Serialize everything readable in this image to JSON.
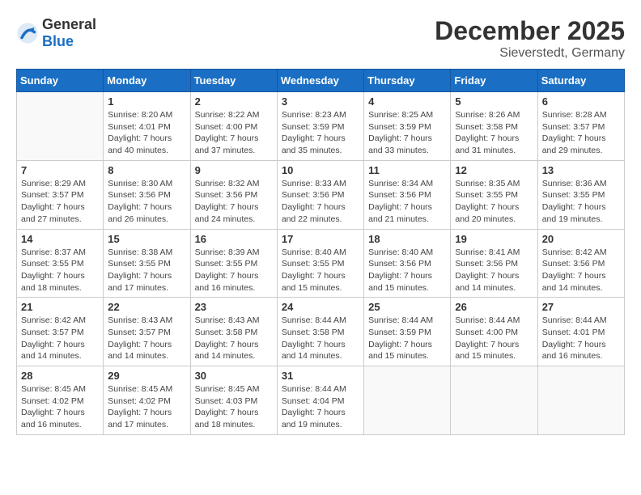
{
  "header": {
    "logo_general": "General",
    "logo_blue": "Blue",
    "month": "December 2025",
    "location": "Sieverstedt, Germany"
  },
  "days_of_week": [
    "Sunday",
    "Monday",
    "Tuesday",
    "Wednesday",
    "Thursday",
    "Friday",
    "Saturday"
  ],
  "weeks": [
    [
      {
        "day": "",
        "sunrise": "",
        "sunset": "",
        "daylight": ""
      },
      {
        "day": "1",
        "sunrise": "Sunrise: 8:20 AM",
        "sunset": "Sunset: 4:01 PM",
        "daylight": "Daylight: 7 hours and 40 minutes."
      },
      {
        "day": "2",
        "sunrise": "Sunrise: 8:22 AM",
        "sunset": "Sunset: 4:00 PM",
        "daylight": "Daylight: 7 hours and 37 minutes."
      },
      {
        "day": "3",
        "sunrise": "Sunrise: 8:23 AM",
        "sunset": "Sunset: 3:59 PM",
        "daylight": "Daylight: 7 hours and 35 minutes."
      },
      {
        "day": "4",
        "sunrise": "Sunrise: 8:25 AM",
        "sunset": "Sunset: 3:59 PM",
        "daylight": "Daylight: 7 hours and 33 minutes."
      },
      {
        "day": "5",
        "sunrise": "Sunrise: 8:26 AM",
        "sunset": "Sunset: 3:58 PM",
        "daylight": "Daylight: 7 hours and 31 minutes."
      },
      {
        "day": "6",
        "sunrise": "Sunrise: 8:28 AM",
        "sunset": "Sunset: 3:57 PM",
        "daylight": "Daylight: 7 hours and 29 minutes."
      }
    ],
    [
      {
        "day": "7",
        "sunrise": "Sunrise: 8:29 AM",
        "sunset": "Sunset: 3:57 PM",
        "daylight": "Daylight: 7 hours and 27 minutes."
      },
      {
        "day": "8",
        "sunrise": "Sunrise: 8:30 AM",
        "sunset": "Sunset: 3:56 PM",
        "daylight": "Daylight: 7 hours and 26 minutes."
      },
      {
        "day": "9",
        "sunrise": "Sunrise: 8:32 AM",
        "sunset": "Sunset: 3:56 PM",
        "daylight": "Daylight: 7 hours and 24 minutes."
      },
      {
        "day": "10",
        "sunrise": "Sunrise: 8:33 AM",
        "sunset": "Sunset: 3:56 PM",
        "daylight": "Daylight: 7 hours and 22 minutes."
      },
      {
        "day": "11",
        "sunrise": "Sunrise: 8:34 AM",
        "sunset": "Sunset: 3:56 PM",
        "daylight": "Daylight: 7 hours and 21 minutes."
      },
      {
        "day": "12",
        "sunrise": "Sunrise: 8:35 AM",
        "sunset": "Sunset: 3:55 PM",
        "daylight": "Daylight: 7 hours and 20 minutes."
      },
      {
        "day": "13",
        "sunrise": "Sunrise: 8:36 AM",
        "sunset": "Sunset: 3:55 PM",
        "daylight": "Daylight: 7 hours and 19 minutes."
      }
    ],
    [
      {
        "day": "14",
        "sunrise": "Sunrise: 8:37 AM",
        "sunset": "Sunset: 3:55 PM",
        "daylight": "Daylight: 7 hours and 18 minutes."
      },
      {
        "day": "15",
        "sunrise": "Sunrise: 8:38 AM",
        "sunset": "Sunset: 3:55 PM",
        "daylight": "Daylight: 7 hours and 17 minutes."
      },
      {
        "day": "16",
        "sunrise": "Sunrise: 8:39 AM",
        "sunset": "Sunset: 3:55 PM",
        "daylight": "Daylight: 7 hours and 16 minutes."
      },
      {
        "day": "17",
        "sunrise": "Sunrise: 8:40 AM",
        "sunset": "Sunset: 3:55 PM",
        "daylight": "Daylight: 7 hours and 15 minutes."
      },
      {
        "day": "18",
        "sunrise": "Sunrise: 8:40 AM",
        "sunset": "Sunset: 3:56 PM",
        "daylight": "Daylight: 7 hours and 15 minutes."
      },
      {
        "day": "19",
        "sunrise": "Sunrise: 8:41 AM",
        "sunset": "Sunset: 3:56 PM",
        "daylight": "Daylight: 7 hours and 14 minutes."
      },
      {
        "day": "20",
        "sunrise": "Sunrise: 8:42 AM",
        "sunset": "Sunset: 3:56 PM",
        "daylight": "Daylight: 7 hours and 14 minutes."
      }
    ],
    [
      {
        "day": "21",
        "sunrise": "Sunrise: 8:42 AM",
        "sunset": "Sunset: 3:57 PM",
        "daylight": "Daylight: 7 hours and 14 minutes."
      },
      {
        "day": "22",
        "sunrise": "Sunrise: 8:43 AM",
        "sunset": "Sunset: 3:57 PM",
        "daylight": "Daylight: 7 hours and 14 minutes."
      },
      {
        "day": "23",
        "sunrise": "Sunrise: 8:43 AM",
        "sunset": "Sunset: 3:58 PM",
        "daylight": "Daylight: 7 hours and 14 minutes."
      },
      {
        "day": "24",
        "sunrise": "Sunrise: 8:44 AM",
        "sunset": "Sunset: 3:58 PM",
        "daylight": "Daylight: 7 hours and 14 minutes."
      },
      {
        "day": "25",
        "sunrise": "Sunrise: 8:44 AM",
        "sunset": "Sunset: 3:59 PM",
        "daylight": "Daylight: 7 hours and 15 minutes."
      },
      {
        "day": "26",
        "sunrise": "Sunrise: 8:44 AM",
        "sunset": "Sunset: 4:00 PM",
        "daylight": "Daylight: 7 hours and 15 minutes."
      },
      {
        "day": "27",
        "sunrise": "Sunrise: 8:44 AM",
        "sunset": "Sunset: 4:01 PM",
        "daylight": "Daylight: 7 hours and 16 minutes."
      }
    ],
    [
      {
        "day": "28",
        "sunrise": "Sunrise: 8:45 AM",
        "sunset": "Sunset: 4:02 PM",
        "daylight": "Daylight: 7 hours and 16 minutes."
      },
      {
        "day": "29",
        "sunrise": "Sunrise: 8:45 AM",
        "sunset": "Sunset: 4:02 PM",
        "daylight": "Daylight: 7 hours and 17 minutes."
      },
      {
        "day": "30",
        "sunrise": "Sunrise: 8:45 AM",
        "sunset": "Sunset: 4:03 PM",
        "daylight": "Daylight: 7 hours and 18 minutes."
      },
      {
        "day": "31",
        "sunrise": "Sunrise: 8:44 AM",
        "sunset": "Sunset: 4:04 PM",
        "daylight": "Daylight: 7 hours and 19 minutes."
      },
      {
        "day": "",
        "sunrise": "",
        "sunset": "",
        "daylight": ""
      },
      {
        "day": "",
        "sunrise": "",
        "sunset": "",
        "daylight": ""
      },
      {
        "day": "",
        "sunrise": "",
        "sunset": "",
        "daylight": ""
      }
    ]
  ]
}
